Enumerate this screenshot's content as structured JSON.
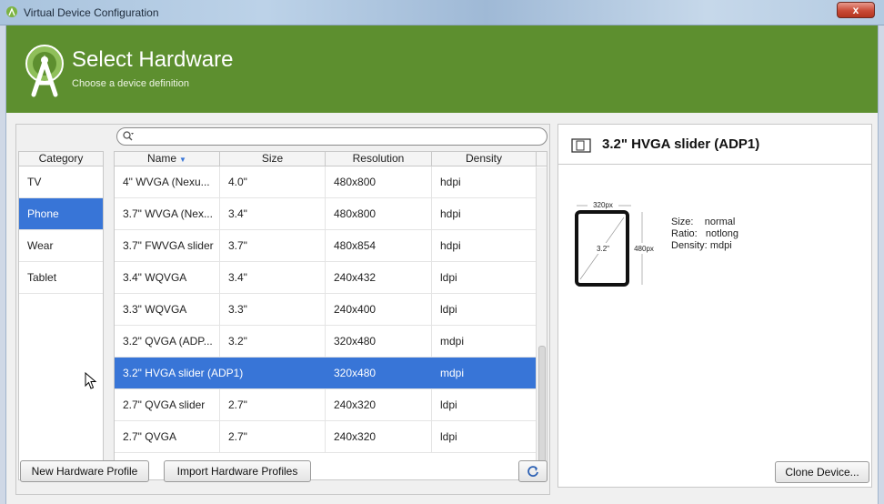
{
  "window": {
    "title": "Virtual Device Configuration",
    "close_label": "x"
  },
  "banner": {
    "heading": "Select Hardware",
    "subheading": "Choose a device definition"
  },
  "search": {
    "value": "",
    "placeholder": ""
  },
  "category": {
    "header": "Category",
    "items": [
      "TV",
      "Phone",
      "Wear",
      "Tablet"
    ],
    "selected": "Phone"
  },
  "table": {
    "columns": [
      "Name",
      "Size",
      "Resolution",
      "Density"
    ],
    "sort_column": "Name",
    "rows": [
      {
        "name": "4\" WVGA (Nexu...",
        "size": "4.0\"",
        "resolution": "480x800",
        "density": "hdpi"
      },
      {
        "name": "3.7\" WVGA (Nex...",
        "size": "3.4\"",
        "resolution": "480x800",
        "density": "hdpi"
      },
      {
        "name": "3.7\" FWVGA slider",
        "size": "3.7\"",
        "resolution": "480x854",
        "density": "hdpi"
      },
      {
        "name": "3.4\" WQVGA",
        "size": "3.4\"",
        "resolution": "240x432",
        "density": "ldpi"
      },
      {
        "name": "3.3\" WQVGA",
        "size": "3.3\"",
        "resolution": "240x400",
        "density": "ldpi"
      },
      {
        "name": "3.2\" QVGA (ADP...",
        "size": "3.2\"",
        "resolution": "320x480",
        "density": "mdpi"
      },
      {
        "name": "3.2\" HVGA slider (ADP1)",
        "size": "",
        "resolution": "320x480",
        "density": "mdpi"
      },
      {
        "name": "2.7\" QVGA slider",
        "size": "2.7\"",
        "resolution": "240x320",
        "density": "ldpi"
      },
      {
        "name": "2.7\" QVGA",
        "size": "2.7\"",
        "resolution": "240x320",
        "density": "ldpi"
      }
    ],
    "selected_index": 6
  },
  "buttons": {
    "new_profile": "New Hardware Profile",
    "import_profiles": "Import Hardware Profiles",
    "clone_device": "Clone Device..."
  },
  "preview": {
    "title": "3.2\" HVGA slider (ADP1)",
    "width_label": "320px",
    "height_label": "480px",
    "diagonal_label": "3.2\"",
    "size_label": "Size:",
    "size_value": "normal",
    "ratio_label": "Ratio:",
    "ratio_value": "notlong",
    "density_label": "Density:",
    "density_value": "mdpi"
  },
  "colors": {
    "banner": "#5d8f2f",
    "selection": "#3875d7"
  },
  "icons": [
    "android-studio-icon",
    "close-icon",
    "search-icon",
    "sort-desc-icon",
    "refresh-icon",
    "device-outline-icon",
    "mouse-pointer-icon"
  ]
}
